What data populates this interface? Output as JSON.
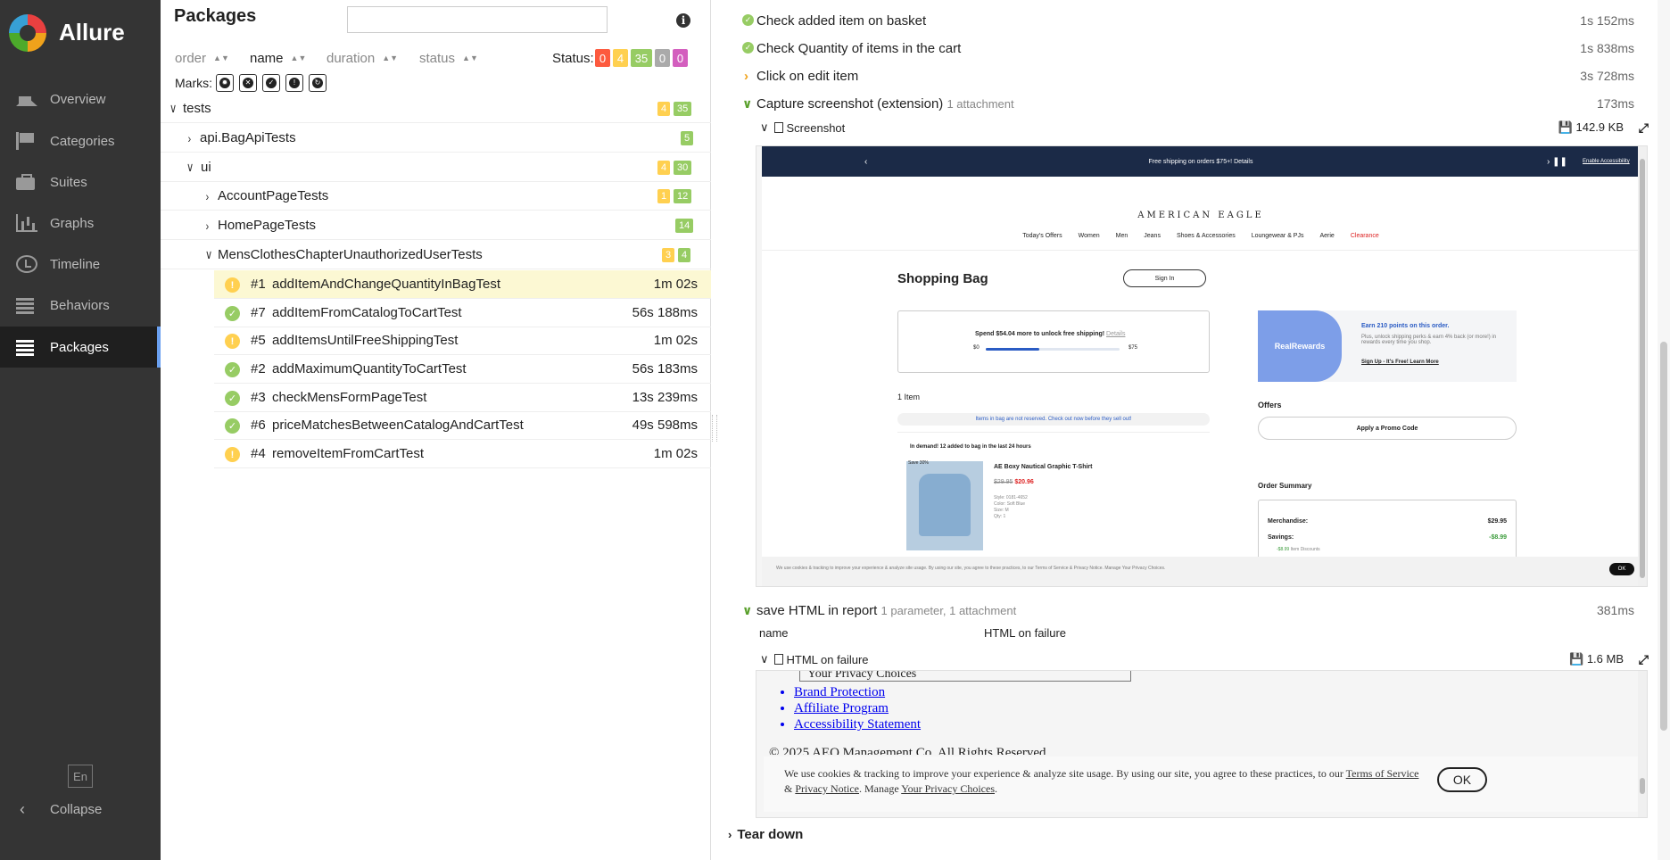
{
  "app": {
    "name": "Allure"
  },
  "sidebar": {
    "items": [
      {
        "label": "Overview",
        "icon": "home-icon"
      },
      {
        "label": "Categories",
        "icon": "flag-icon"
      },
      {
        "label": "Suites",
        "icon": "briefcase-icon"
      },
      {
        "label": "Graphs",
        "icon": "bar-chart-icon"
      },
      {
        "label": "Timeline",
        "icon": "clock-icon"
      },
      {
        "label": "Behaviors",
        "icon": "list-icon"
      },
      {
        "label": "Packages",
        "icon": "packages-icon",
        "active": true
      }
    ],
    "language": "En",
    "collapse_label": "Collapse"
  },
  "packages": {
    "title": "Packages",
    "search": {
      "value": "",
      "placeholder": ""
    },
    "sort": {
      "order": "order",
      "name": "name",
      "duration": "duration",
      "status": "status"
    },
    "status_label": "Status:",
    "status_counts": [
      {
        "value": "0",
        "color": "#fd5a3e"
      },
      {
        "value": "4",
        "color": "#ffd050"
      },
      {
        "value": "35",
        "color": "#97cc64"
      },
      {
        "value": "0",
        "color": "#aaaaaa"
      },
      {
        "value": "0",
        "color": "#d35ebe"
      }
    ],
    "marks_label": "Marks:",
    "marks": [
      "flaky-icon",
      "new-failed-icon",
      "new-passed-icon",
      "new-broken-icon",
      "retries-icon"
    ],
    "tree": {
      "tests": {
        "label": "tests",
        "broken": "4",
        "passed": "35"
      },
      "api": {
        "label": "api.BagApiTests",
        "passed": "5"
      },
      "ui": {
        "label": "ui",
        "broken": "4",
        "passed": "30"
      },
      "account": {
        "label": "AccountPageTests",
        "broken": "1",
        "passed": "12"
      },
      "home": {
        "label": "HomePageTests",
        "passed": "14"
      },
      "mens": {
        "label": "MensClothesChapterUnauthorizedUserTests",
        "broken": "3",
        "passed": "4"
      }
    },
    "tests": [
      {
        "num": "#1",
        "name": "addItemAndChangeQuantityInBagTest",
        "duration": "1m 02s",
        "status": "broken",
        "selected": true
      },
      {
        "num": "#7",
        "name": "addItemFromCatalogToCartTest",
        "duration": "56s 188ms",
        "status": "passed"
      },
      {
        "num": "#5",
        "name": "addItemsUntilFreeShippingTest",
        "duration": "1m 02s",
        "status": "broken"
      },
      {
        "num": "#2",
        "name": "addMaximumQuantityToCartTest",
        "duration": "56s 183ms",
        "status": "passed"
      },
      {
        "num": "#3",
        "name": "checkMensFormPageTest",
        "duration": "13s 239ms",
        "status": "passed"
      },
      {
        "num": "#6",
        "name": "priceMatchesBetweenCatalogAndCartTest",
        "duration": "49s 598ms",
        "status": "passed"
      },
      {
        "num": "#4",
        "name": "removeItemFromCartTest",
        "duration": "1m 02s",
        "status": "broken"
      }
    ]
  },
  "details": {
    "steps": [
      {
        "label": "Check added item on basket",
        "duration": "1s 152ms"
      },
      {
        "label": "Check Quantity of items in the cart",
        "duration": "1s 838ms"
      },
      {
        "label": "Click on edit item",
        "duration": "3s 728ms"
      },
      {
        "label": "Capture screenshot (extension)",
        "sub": "1 attachment",
        "duration": "173ms"
      }
    ],
    "screenshot_attachment": {
      "name": "Screenshot",
      "size": "142.9 KB"
    },
    "save_step": {
      "label": "save HTML in report",
      "sub": "1 parameter, 1 attachment",
      "duration": "381ms"
    },
    "param": {
      "name": "name",
      "value": "HTML on failure"
    },
    "html_attachment": {
      "name": "HTML on failure",
      "size": "1.6 MB"
    },
    "teardown_label": "Tear down"
  },
  "screenshot": {
    "banner": "Free shipping on orders $75+! Details",
    "banner_right": "Enable Accessibility",
    "logo": "AMERICAN EAGLE",
    "menu": [
      "Today's Offers",
      "Women",
      "Men",
      "Jeans",
      "Shoes & Accessories",
      "Loungewear & PJs",
      "Aerie",
      "Clearance"
    ],
    "heading": "Shopping Bag",
    "sign_in": "Sign In",
    "shipping_msg": "Spend $54.04 more to unlock free shipping!",
    "shipping_details": "Details",
    "shipping_min": "$0",
    "shipping_max": "$75",
    "rr_logo": "RealRewards",
    "rr_title": "Earn 210 points on this order.",
    "rr_desc": "Plus, unlock shipping perks & earn 4% back (or more!) in rewards every time you shop.",
    "rr_links": "Sign Up - It's Free!   Learn More",
    "items_count": "1 Item",
    "not_reserved": "Items in bag are not reserved. Check out now before they sell out!",
    "offers": "Offers",
    "promo": "Apply a Promo Code",
    "demand": "In demand! 12 added to bag in the last 24 hours",
    "save_pct": "Save 30%",
    "product": "AE Boxy Nautical Graphic T-Shirt",
    "old_price": "$29.95",
    "new_price": "$20.96",
    "style": "Style: 0181-4652",
    "color": "Color: Soft Blue",
    "size": "Size: M",
    "qty": "Qty: 1",
    "order_summary": "Order Summary",
    "merch_label": "Merchandise:",
    "merch_value": "$29.95",
    "savings_label": "Savings:",
    "savings_value": "-$8.99",
    "discount_value": "-$8.99",
    "discount_label": "Item Discounts",
    "cookie": "We use cookies & tracking to improve your experience & analyze site usage. By using our site, you agree to these practices, to our Terms of Service & Privacy Notice. Manage Your Privacy Choices.",
    "ok": "OK"
  },
  "html_preview": {
    "top_cut": "Your Privacy Choices",
    "links": [
      "Brand Protection",
      "Affiliate Program",
      "Accessibility Statement"
    ],
    "copyright": "© 2025 AEO Management Co. All Rights Reserved.",
    "cookie_a": "We use cookies & tracking to improve your experience & analyze site usage. By using our site, you agree to these practices, to our",
    "tos": "Terms of Service",
    "amp": "&",
    "privacy": "Privacy Notice",
    "manage": ". Manage",
    "choices": "Your Privacy Choices",
    "ok": "OK"
  }
}
